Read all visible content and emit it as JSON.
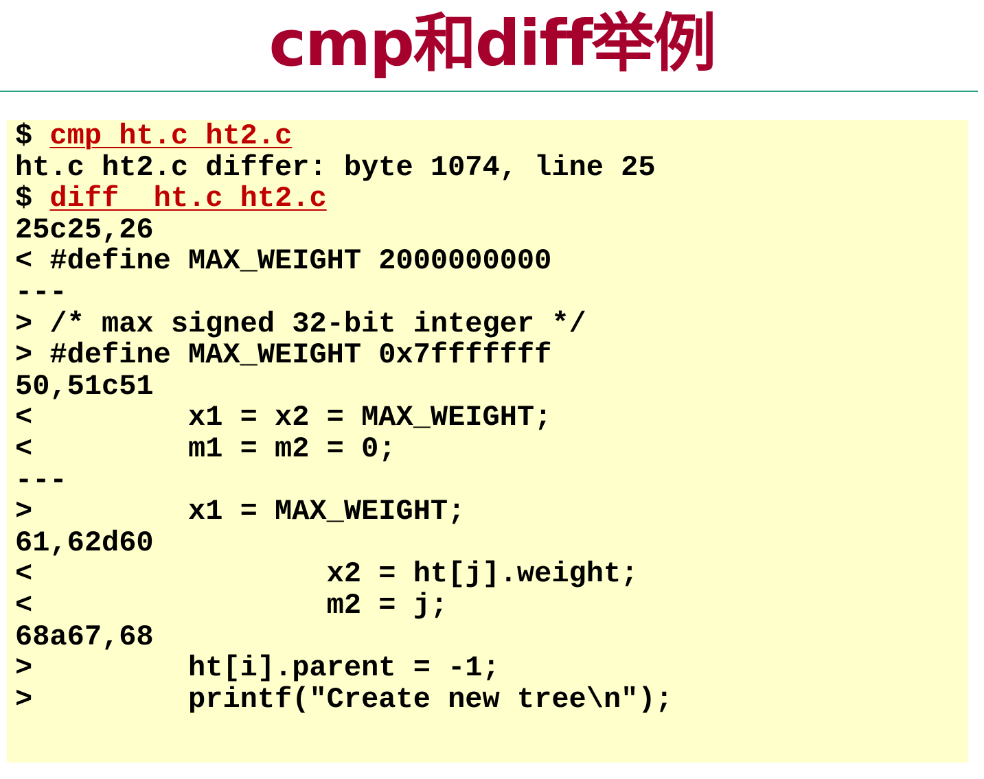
{
  "title": "cmp和diff举例",
  "colors": {
    "title": "#a6002c",
    "rule": "#2aa184",
    "code_background": "#ffffcc",
    "command_link": "#c00000"
  },
  "terminal": {
    "commands": [
      {
        "prompt": "$ ",
        "command": "cmp ht.c ht2.c"
      },
      {
        "prompt": "$ ",
        "command": "diff  ht.c ht2.c"
      }
    ],
    "cmp_output": "ht.c ht2.c differ: byte 1074, line 25",
    "diff_output": [
      "25c25,26",
      "< #define MAX_WEIGHT 2000000000",
      "---",
      "> /* max signed 32-bit integer */",
      "> #define MAX_WEIGHT 0x7fffffff",
      "50,51c51",
      "<         x1 = x2 = MAX_WEIGHT;",
      "<         m1 = m2 = 0;",
      "---",
      ">         x1 = MAX_WEIGHT;",
      "61,62d60",
      "<                 x2 = ht[j].weight;",
      "<                 m2 = j;",
      "68a67,68",
      ">         ht[i].parent = -1;",
      ">         printf(\"Create new tree\\n\");"
    ]
  }
}
